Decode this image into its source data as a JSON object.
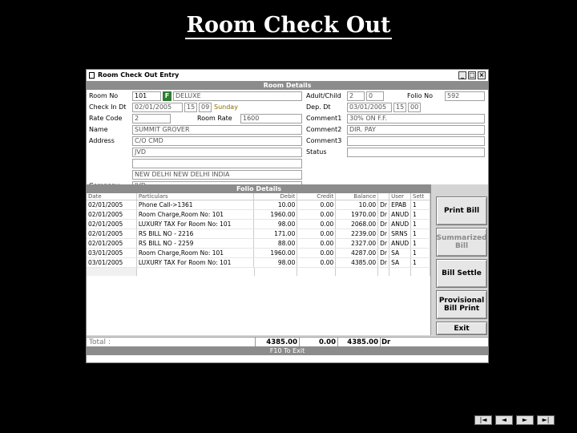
{
  "slide": {
    "title": "Room Check Out"
  },
  "window": {
    "title": "Room Check Out Entry",
    "buttons": {
      "minimize": "_",
      "maximize": "□",
      "close": "×"
    }
  },
  "room_details": {
    "header": "Room Details",
    "room_no_label": "Room No",
    "room_no": "101",
    "f9": "F",
    "room_type": "DELUXE",
    "checkin_label": "Check In Dt",
    "checkin_date": "02/01/2005",
    "checkin_hh": "15",
    "checkin_mm": "09",
    "checkin_day": "Sunday",
    "rate_code_label": "Rate Code",
    "rate_code": "2",
    "room_rate_label": "Room Rate",
    "room_rate": "1600",
    "name_label": "Name",
    "name": "SUMMIT GROVER",
    "address_label": "Address",
    "address_1": "C/O CMD",
    "address_2": "JVD",
    "address_3": "",
    "address_4": "NEW DELHI NEW DELHI INDIA",
    "company_label": "Company",
    "company": "JVD",
    "adult_child_label": "Adult/Child",
    "adult": "2",
    "child": "0",
    "folio_no_label": "Folio No",
    "folio_no": "592",
    "dep_dt_label": "Dep. Dt",
    "dep_date": "03/01/2005",
    "dep_hh": "15",
    "dep_mm": "00",
    "comment1_label": "Comment1",
    "comment1": "30% ON F.F.",
    "comment2_label": "Comment2",
    "comment2": "DIR. PAY",
    "comment3_label": "Comment3",
    "comment3": "",
    "status_label": "Status",
    "status": ""
  },
  "folio_details": {
    "header": "Folio Details",
    "columns": {
      "date": "Date",
      "particulars": "Particulars",
      "debit": "Debit",
      "credit": "Credit",
      "balance": "Balance",
      "dr": "",
      "user": "User",
      "sett": "Sett"
    },
    "rows": [
      {
        "date": "02/01/2005",
        "particulars": "Phone Call->1361",
        "debit": "10.00",
        "credit": "0.00",
        "balance": "10.00",
        "dr": "Dr",
        "user": "EPAB",
        "sett": "1"
      },
      {
        "date": "02/01/2005",
        "particulars": "Room Charge,Room No: 101",
        "debit": "1960.00",
        "credit": "0.00",
        "balance": "1970.00",
        "dr": "Dr",
        "user": "ANUD",
        "sett": "1"
      },
      {
        "date": "02/01/2005",
        "particulars": "LUXURY TAX For Room No: 101",
        "debit": "98.00",
        "credit": "0.00",
        "balance": "2068.00",
        "dr": "Dr",
        "user": "ANUD",
        "sett": "1"
      },
      {
        "date": "02/01/2005",
        "particulars": "RS BILL NO - 2216",
        "debit": "171.00",
        "credit": "0.00",
        "balance": "2239.00",
        "dr": "Dr",
        "user": "SRNS",
        "sett": "1"
      },
      {
        "date": "02/01/2005",
        "particulars": "RS BILL NO - 2259",
        "debit": "88.00",
        "credit": "0.00",
        "balance": "2327.00",
        "dr": "Dr",
        "user": "ANUD",
        "sett": "1"
      },
      {
        "date": "03/01/2005",
        "particulars": "Room Charge,Room No: 101",
        "debit": "1960.00",
        "credit": "0.00",
        "balance": "4287.00",
        "dr": "Dr",
        "user": "SA",
        "sett": "1"
      },
      {
        "date": "03/01/2005",
        "particulars": "LUXURY TAX For Room No: 101",
        "debit": "98.00",
        "credit": "0.00",
        "balance": "4385.00",
        "dr": "Dr",
        "user": "SA",
        "sett": "1"
      }
    ]
  },
  "actions": {
    "print_bill": "Print Bill",
    "summarized_bill": "Summarized Bill",
    "bill_settle": "Bill Settle",
    "provisional_bill_print": "Provisional Bill Print",
    "exit": "Exit"
  },
  "totals": {
    "label": "Total :",
    "debit": "4385.00",
    "credit": "0.00",
    "balance": "4385.00",
    "dr": "Dr"
  },
  "footer": {
    "hint": "F10 To Exit"
  },
  "nav": {
    "first": "|◄",
    "prev": "◄",
    "next": "►",
    "last": "►|"
  },
  "colors": {
    "section_bar": "#8c8c8c",
    "f9_button": "#2e7d32",
    "background": "#000000"
  }
}
